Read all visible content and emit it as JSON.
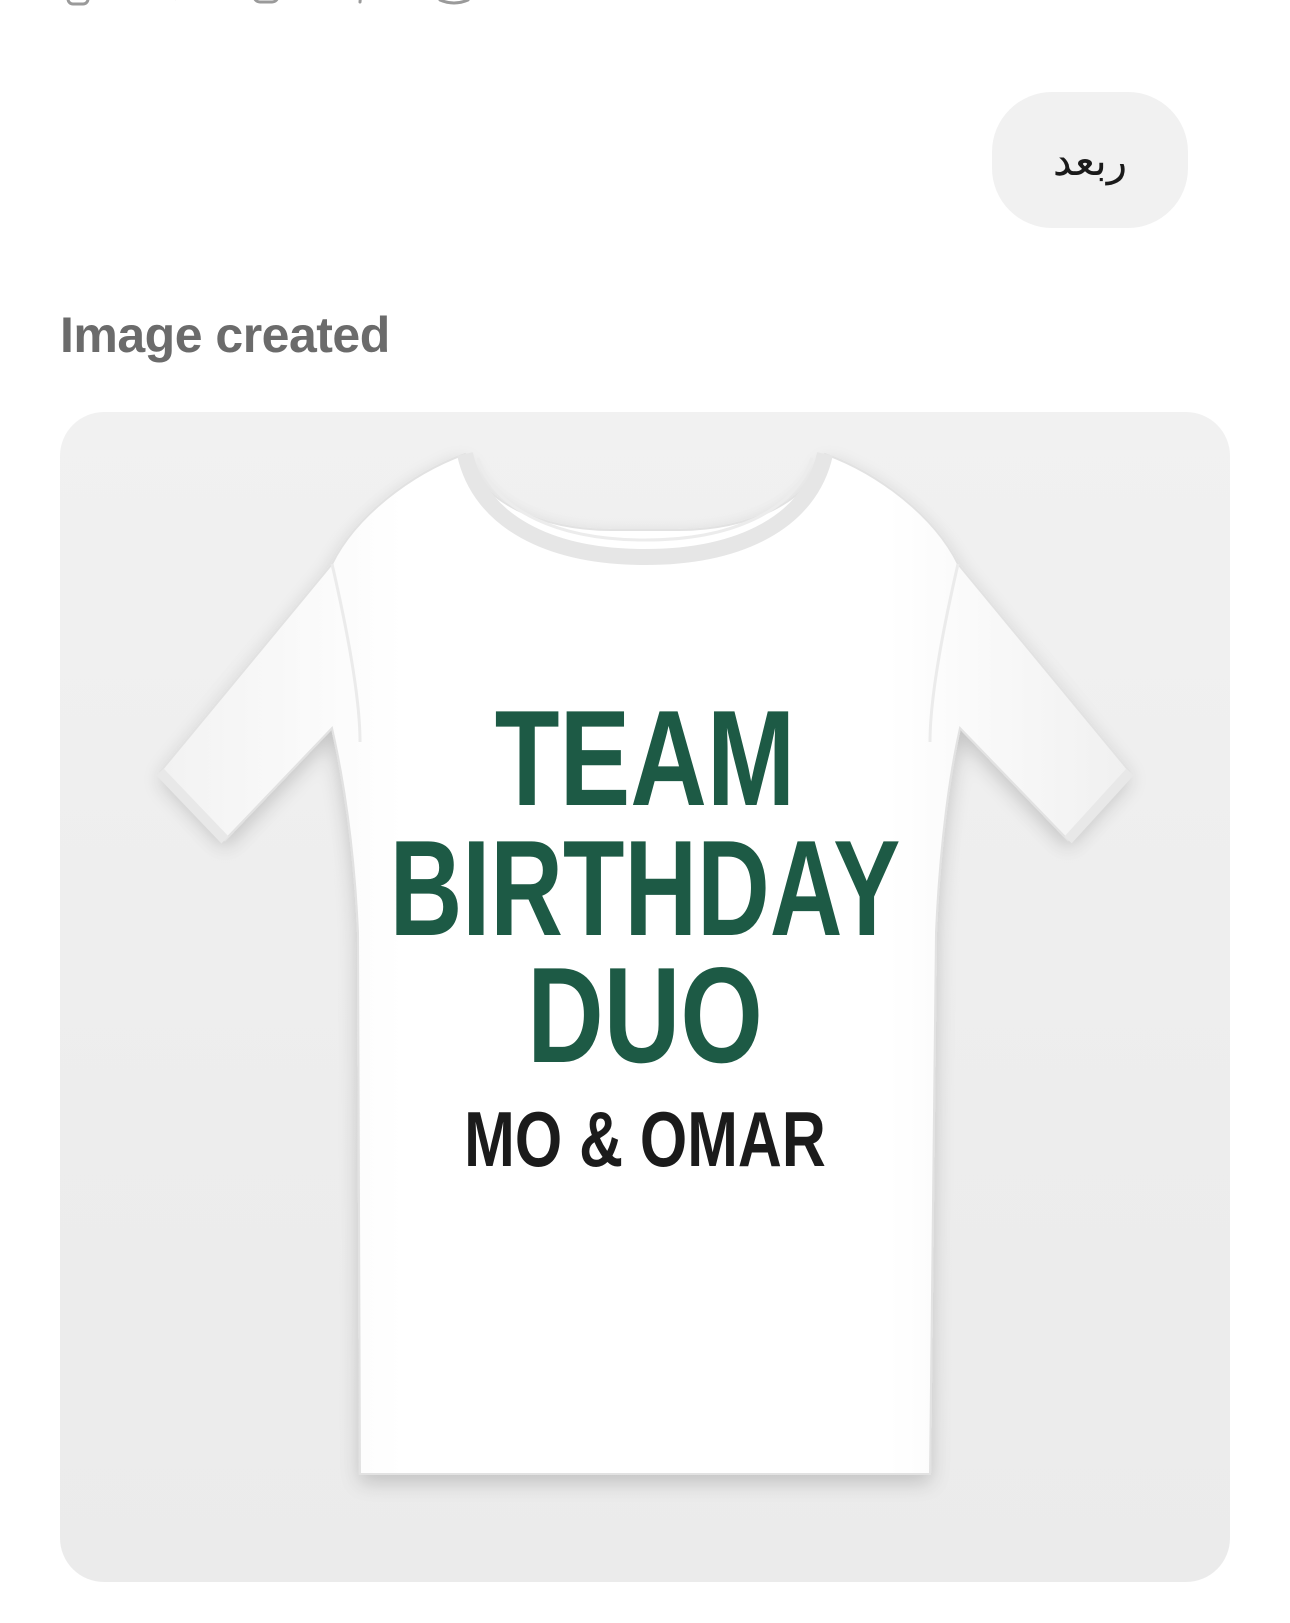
{
  "top_actions": [
    {
      "icon": "copy-icon"
    },
    {
      "icon": "thumbs-up-icon"
    },
    {
      "icon": "thumbs-down-icon"
    },
    {
      "icon": "speaker-icon"
    },
    {
      "icon": "share-icon"
    },
    {
      "icon": "regenerate-icon"
    }
  ],
  "user_message": {
    "text": "ربعد"
  },
  "assistant": {
    "status_label": "Image created"
  },
  "generated_image": {
    "subject": "t-shirt",
    "shirt_text": {
      "line1": "TEAM",
      "line2": "BIRTHDAY",
      "line3": "DUO",
      "line4": "MO & OMAR"
    },
    "colors": {
      "print_green": "#1d5a45",
      "print_black": "#1b1b1b",
      "shirt": "#ffffff",
      "card_bg": "#efefef",
      "bubble_bg": "#f1f1f1",
      "status_gray": "#6b6b6b"
    }
  }
}
